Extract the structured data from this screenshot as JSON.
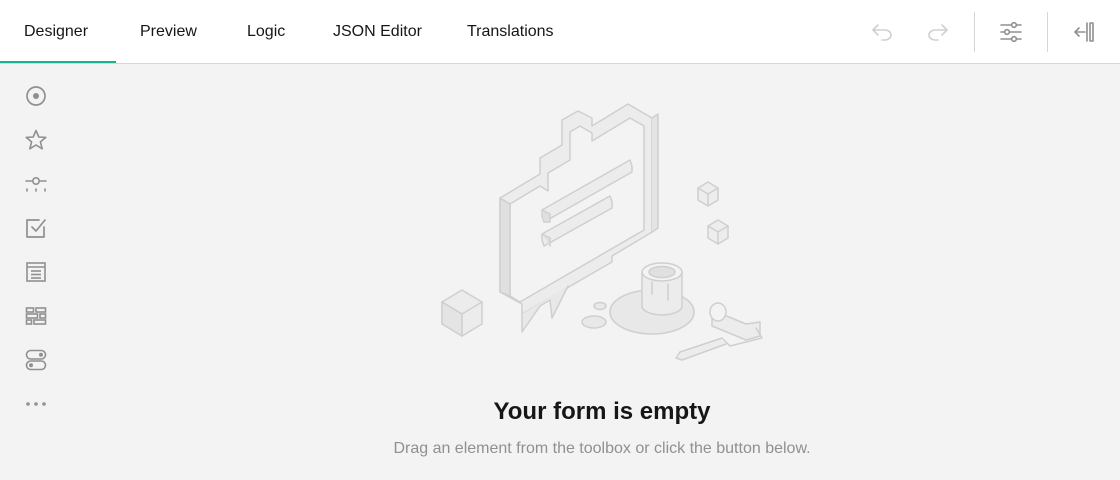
{
  "tabs": [
    {
      "label": "Designer",
      "active": true
    },
    {
      "label": "Preview",
      "active": false
    },
    {
      "label": "Logic",
      "active": false
    },
    {
      "label": "JSON Editor",
      "active": false
    },
    {
      "label": "Translations",
      "active": false
    }
  ],
  "toolbar": {
    "buttons": [
      {
        "icon": "undo-icon",
        "enabled": false
      },
      {
        "icon": "redo-icon",
        "enabled": false
      },
      {
        "icon": "settings-sliders-icon",
        "enabled": true
      },
      {
        "icon": "collapse-panel-icon",
        "enabled": true
      }
    ]
  },
  "toolbox": {
    "items": [
      {
        "icon": "radio-group-icon"
      },
      {
        "icon": "rating-star-icon"
      },
      {
        "icon": "slider-icon"
      },
      {
        "icon": "checkbox-icon"
      },
      {
        "icon": "list-icon"
      },
      {
        "icon": "ranking-icon"
      },
      {
        "icon": "toggle-icon"
      },
      {
        "icon": "more-icon"
      }
    ]
  },
  "empty_state": {
    "title": "Your form is empty",
    "subtitle": "Drag an element from the toolbox or click the button below."
  },
  "colors": {
    "accent": "#19b394",
    "icon": "#909090",
    "background": "#f3f3f3"
  }
}
